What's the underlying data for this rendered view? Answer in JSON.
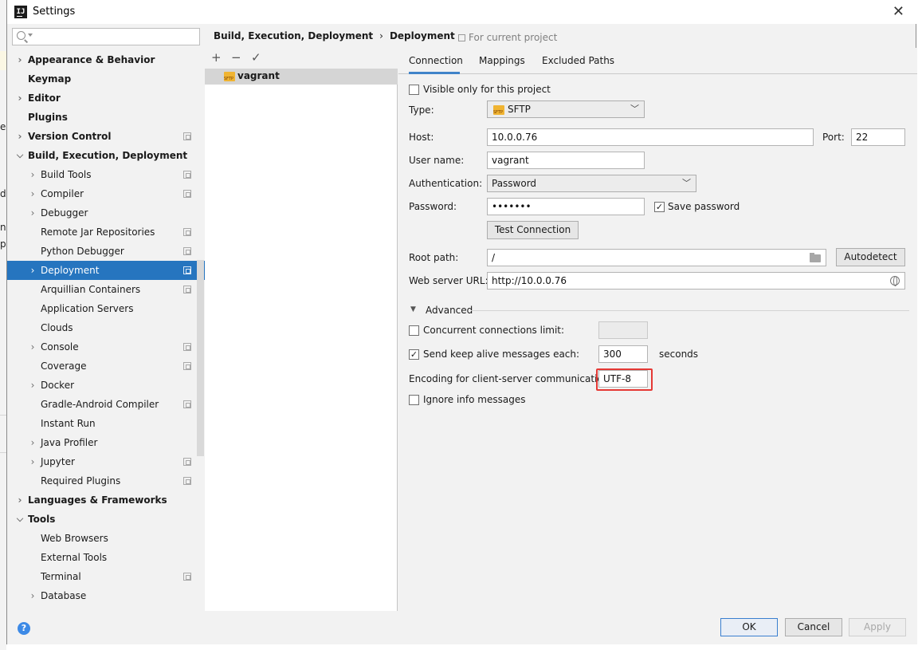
{
  "window": {
    "title": "Settings",
    "app_icon_text": "IJ"
  },
  "background_chars": [
    "e",
    "d",
    "n",
    "p"
  ],
  "sidebar": {
    "search_placeholder": "",
    "items": [
      {
        "label": "Appearance & Behavior",
        "level": 0,
        "arrow": "right",
        "project": false
      },
      {
        "label": "Keymap",
        "level": 0,
        "arrow": "none",
        "project": false
      },
      {
        "label": "Editor",
        "level": 0,
        "arrow": "right",
        "project": false
      },
      {
        "label": "Plugins",
        "level": 0,
        "arrow": "none",
        "project": false
      },
      {
        "label": "Version Control",
        "level": 0,
        "arrow": "right",
        "project": true
      },
      {
        "label": "Build, Execution, Deployment",
        "level": 0,
        "arrow": "down",
        "project": false
      },
      {
        "label": "Build Tools",
        "level": 1,
        "arrow": "right",
        "project": true
      },
      {
        "label": "Compiler",
        "level": 1,
        "arrow": "right",
        "project": true
      },
      {
        "label": "Debugger",
        "level": 1,
        "arrow": "right",
        "project": false
      },
      {
        "label": "Remote Jar Repositories",
        "level": 1,
        "arrow": "none",
        "project": true
      },
      {
        "label": "Python Debugger",
        "level": 1,
        "arrow": "none",
        "project": true
      },
      {
        "label": "Deployment",
        "level": 1,
        "arrow": "right",
        "project": true,
        "selected": true
      },
      {
        "label": "Arquillian Containers",
        "level": 1,
        "arrow": "none",
        "project": true
      },
      {
        "label": "Application Servers",
        "level": 1,
        "arrow": "none",
        "project": false
      },
      {
        "label": "Clouds",
        "level": 1,
        "arrow": "none",
        "project": false
      },
      {
        "label": "Console",
        "level": 1,
        "arrow": "right",
        "project": true
      },
      {
        "label": "Coverage",
        "level": 1,
        "arrow": "none",
        "project": true
      },
      {
        "label": "Docker",
        "level": 1,
        "arrow": "right",
        "project": false
      },
      {
        "label": "Gradle-Android Compiler",
        "level": 1,
        "arrow": "none",
        "project": true
      },
      {
        "label": "Instant Run",
        "level": 1,
        "arrow": "none",
        "project": false
      },
      {
        "label": "Java Profiler",
        "level": 1,
        "arrow": "right",
        "project": false
      },
      {
        "label": "Jupyter",
        "level": 1,
        "arrow": "right",
        "project": true
      },
      {
        "label": "Required Plugins",
        "level": 1,
        "arrow": "none",
        "project": true
      },
      {
        "label": "Languages & Frameworks",
        "level": 0,
        "arrow": "right",
        "project": false
      },
      {
        "label": "Tools",
        "level": 0,
        "arrow": "down",
        "project": false
      },
      {
        "label": "Web Browsers",
        "level": 1,
        "arrow": "none",
        "project": false
      },
      {
        "label": "External Tools",
        "level": 1,
        "arrow": "none",
        "project": false
      },
      {
        "label": "Terminal",
        "level": 1,
        "arrow": "none",
        "project": true
      },
      {
        "label": "Database",
        "level": 1,
        "arrow": "right",
        "project": false
      }
    ]
  },
  "breadcrumb": {
    "parent": "Build, Execution, Deployment",
    "separator": "›",
    "current": "Deployment",
    "for_current_project": "For current project"
  },
  "servers": {
    "toolbar": {
      "add": "+",
      "remove": "−",
      "apply": "✓"
    },
    "items": [
      {
        "name": "vagrant",
        "type_icon": "sftp-icon"
      }
    ]
  },
  "tabs": [
    {
      "label": "Connection",
      "active": true
    },
    {
      "label": "Mappings",
      "active": false
    },
    {
      "label": "Excluded Paths",
      "active": false
    }
  ],
  "connection": {
    "visible_only_label": "Visible only for this project",
    "visible_only_checked": false,
    "type_label": "Type:",
    "type_value": "SFTP",
    "host_label": "Host:",
    "host_value": "10.0.0.76",
    "port_label": "Port:",
    "port_value": "22",
    "username_label": "User name:",
    "username_value": "vagrant",
    "auth_label": "Authentication:",
    "auth_value": "Password",
    "password_label": "Password:",
    "password_value": "•••••••",
    "save_password_label": "Save password",
    "save_password_checked": true,
    "test_connection_label": "Test Connection",
    "root_path_label": "Root path:",
    "root_path_value": "/",
    "autodetect_label": "Autodetect",
    "web_url_label": "Web server URL:",
    "web_url_value": "http://10.0.0.76"
  },
  "advanced": {
    "section_label": "Advanced",
    "expand_glyph": "▼",
    "concurrent_label": "Concurrent connections limit:",
    "concurrent_checked": false,
    "concurrent_value": "",
    "keepalive_label": "Send keep alive messages each:",
    "keepalive_checked": true,
    "keepalive_value": "300",
    "keepalive_unit": "seconds",
    "encoding_label": "Encoding for client-server communication:",
    "encoding_value": "UTF-8",
    "ignore_info_label": "Ignore info messages",
    "ignore_info_checked": false
  },
  "footer": {
    "help": "?",
    "ok": "OK",
    "cancel": "Cancel",
    "apply": "Apply"
  },
  "colors": {
    "selection": "#2675bf",
    "highlight_box": "#e53935",
    "tab_underline": "#4083c9",
    "help_icon": "#3d8ae6"
  }
}
